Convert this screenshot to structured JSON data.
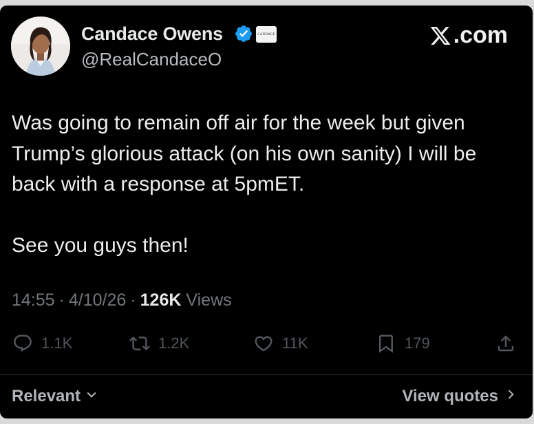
{
  "author": {
    "name": "Candace Owens",
    "handle": "@RealCandaceO",
    "affiliate_badge": "CANDACE"
  },
  "brand": {
    "site_text": ".com",
    "icon": "x-logo-icon"
  },
  "tweet": {
    "paragraphs": [
      "Was going to remain off air for the week but given Trump’s glorious attack (on his own sanity) I will be back with a response at 5pmET.",
      "See you guys then!"
    ],
    "time": "14:55",
    "date": "4/10/26",
    "views_count": "126K",
    "views_label": "Views"
  },
  "actions": {
    "replies": "1.1K",
    "reposts": "1.2K",
    "likes": "11K",
    "bookmarks": "179"
  },
  "footer": {
    "sort_label": "Relevant",
    "quotes_label": "View quotes"
  },
  "colors": {
    "background": "#000000",
    "verified": "#1d9bf0",
    "muted": "#71767b"
  }
}
